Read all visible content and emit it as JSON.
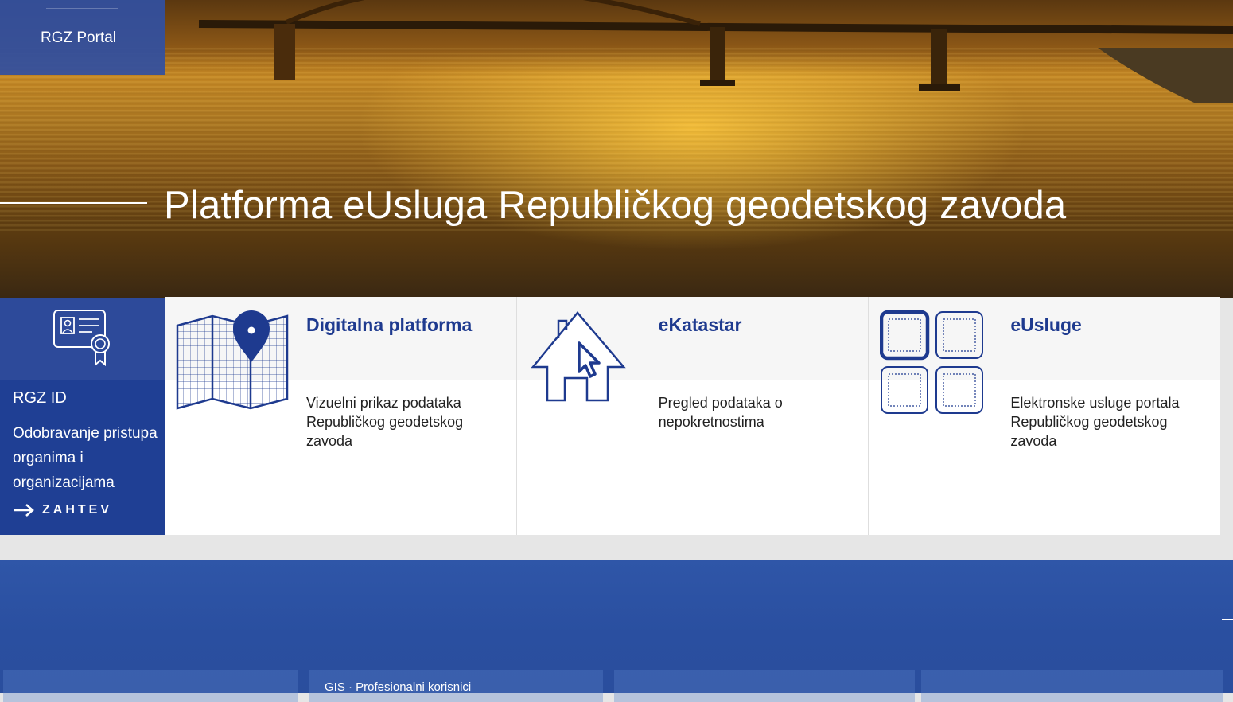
{
  "portal": {
    "label": "RGZ Portal"
  },
  "hero": {
    "title": "Platforma eUsluga Republičkog geodetskog zavoda"
  },
  "rgz_id": {
    "title": "RGZ ID",
    "description": "Odobravanje pristupa organima i organizacijama",
    "action_label": "ZAHTEV",
    "icon": "certificate-icon"
  },
  "cards": [
    {
      "title": "Digitalna platforma",
      "description": "Vizuelni prikaz podataka Republičkog geodetskog zavoda",
      "icon": "map-pin-icon"
    },
    {
      "title": "eKatastar",
      "description": "Pregled podataka o nepokretnostima",
      "icon": "house-cursor-icon"
    },
    {
      "title": "eUsluge",
      "description": "Elektronske usluge portala Republičkog geodetskog zavoda",
      "icon": "grid-squares-icon"
    }
  ],
  "bottom_tiles": [
    {
      "label": ""
    },
    {
      "label": "GIS · Profesionalni korisnici"
    },
    {
      "label": ""
    },
    {
      "label": ""
    }
  ],
  "colors": {
    "primary_blue": "#1e3a8f",
    "panel_blue": "#1f3f94",
    "band_blue": "#2a4fa0",
    "hero_gold": "#c98a24"
  }
}
